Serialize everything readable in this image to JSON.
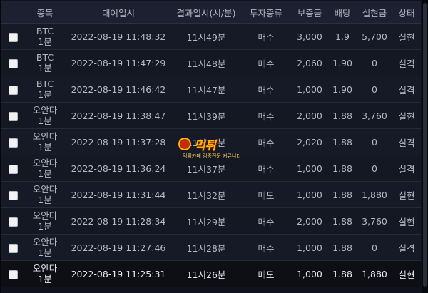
{
  "headers": {
    "check": "",
    "name": "종목",
    "time": "대여일시",
    "result_time": "결과일시(시/분)",
    "type": "투자종류",
    "deposit": "보증금",
    "rate": "배당",
    "payout": "실현금",
    "status": "상태"
  },
  "rows": [
    {
      "name1": "BTC",
      "name2": "1분",
      "time": "2022-08-19 11:48:32",
      "result": "11시49분",
      "type": "매수",
      "deposit": "3,000",
      "rate": "1.9",
      "payout": "5,700",
      "status": "실현",
      "status_kind": "win"
    },
    {
      "name1": "BTC",
      "name2": "1분",
      "time": "2022-08-19 11:47:29",
      "result": "11시48분",
      "type": "매수",
      "deposit": "2,060",
      "rate": "1.90",
      "payout": "0",
      "status": "실격",
      "status_kind": "lose"
    },
    {
      "name1": "BTC",
      "name2": "1분",
      "time": "2022-08-19 11:46:42",
      "result": "11시47분",
      "type": "매수",
      "deposit": "1,000",
      "rate": "1.90",
      "payout": "0",
      "status": "실격",
      "status_kind": "lose"
    },
    {
      "name1": "오안다",
      "name2": "1분",
      "time": "2022-08-19 11:38:47",
      "result": "11시39분",
      "type": "매수",
      "deposit": "2,000",
      "rate": "1.88",
      "payout": "3,760",
      "status": "실현",
      "status_kind": "win"
    },
    {
      "name1": "오안다",
      "name2": "1분",
      "time": "2022-08-19 11:37:28",
      "result": "11시38분",
      "type": "매수",
      "deposit": "2,020",
      "rate": "1.88",
      "payout": "0",
      "status": "실격",
      "status_kind": "lose"
    },
    {
      "name1": "오안다",
      "name2": "1분",
      "time": "2022-08-19 11:36:24",
      "result": "11시37분",
      "type": "매수",
      "deposit": "1,000",
      "rate": "1.88",
      "payout": "0",
      "status": "실격",
      "status_kind": "lose"
    },
    {
      "name1": "오안다",
      "name2": "1분",
      "time": "2022-08-19 11:31:44",
      "result": "11시32분",
      "type": "매도",
      "deposit": "1,000",
      "rate": "1.88",
      "payout": "1,880",
      "status": "실현",
      "status_kind": "win"
    },
    {
      "name1": "오안다",
      "name2": "1분",
      "time": "2022-08-19 11:28:34",
      "result": "11시29분",
      "type": "매수",
      "deposit": "2,000",
      "rate": "1.88",
      "payout": "3,760",
      "status": "실현",
      "status_kind": "win"
    },
    {
      "name1": "오안다",
      "name2": "1분",
      "time": "2022-08-19 11:27:46",
      "result": "11시28분",
      "type": "매수",
      "deposit": "1,000",
      "rate": "1.88",
      "payout": "0",
      "status": "실격",
      "status_kind": "lose"
    },
    {
      "name1": "오안다",
      "name2": "1분",
      "time": "2022-08-19 11:25:31",
      "result": "11시26분",
      "type": "매도",
      "deposit": "1,000",
      "rate": "1.88",
      "payout": "1,880",
      "status": "실현",
      "status_kind": "win"
    }
  ],
  "watermark": {
    "main": "먹튀",
    "sub": "먹튀카페 검증전문 커뮤니티"
  },
  "colors": {
    "win": "#2fbf4a",
    "lose": "#e04646",
    "background": "#10131d",
    "header_bg": "#1c2030"
  }
}
